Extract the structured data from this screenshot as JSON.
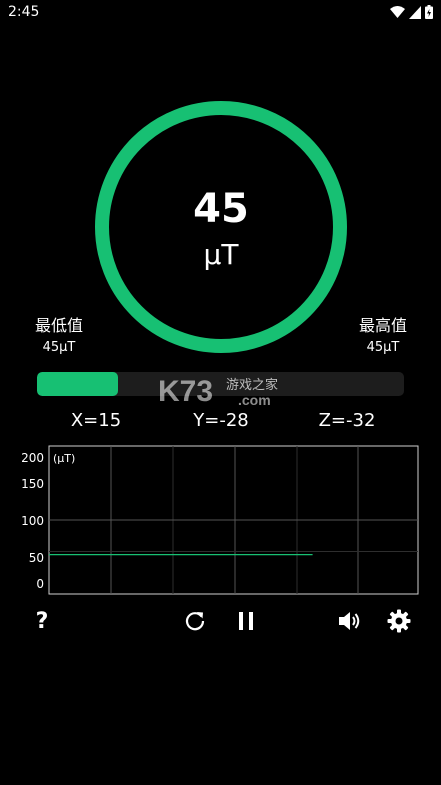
{
  "status_bar": {
    "time": "2:45",
    "icons": [
      "wifi-icon",
      "cell-signal-icon",
      "battery-icon"
    ]
  },
  "gauge": {
    "value": "45",
    "unit": "μT",
    "ring_color": "#17c073"
  },
  "min": {
    "label": "最低值",
    "value": "45μT"
  },
  "max": {
    "label": "最高值",
    "value": "45μT"
  },
  "level_bar": {
    "fraction": 0.22,
    "color": "#17c073"
  },
  "watermark": {
    "brand": "K73",
    "text": "游戏之家",
    "domain": ".com"
  },
  "axes": {
    "x": "X=15",
    "y": "Y=-28",
    "z": "Z=-32"
  },
  "chart_data": {
    "type": "line",
    "ylabel": "(μT)",
    "ylim": [
      0,
      200
    ],
    "y_ticks": [
      "200",
      "150",
      "100",
      "50",
      "0"
    ],
    "series": [
      {
        "x": [
          0,
          1
        ],
        "values": [
          45,
          45
        ]
      }
    ],
    "x_range": [
      0,
      1.4
    ],
    "grid": true,
    "line_color": "#17c073"
  },
  "controls": {
    "help_label": "?",
    "icons": [
      "help-icon",
      "refresh-icon",
      "pause-icon",
      "sound-icon",
      "settings-icon"
    ]
  }
}
